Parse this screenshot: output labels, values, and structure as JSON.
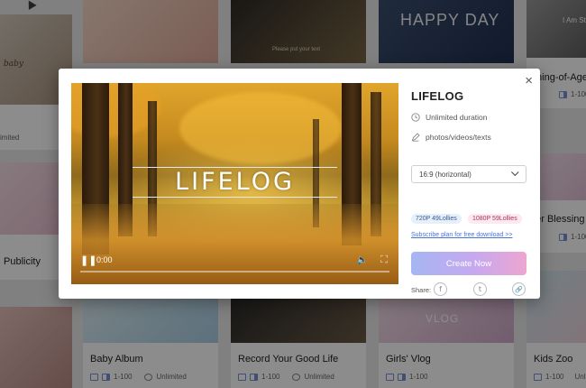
{
  "gallery": {
    "cards": [
      {
        "title": "re",
        "meta": "Unlimited",
        "size": "",
        "thumb_colors": [
          "#d8cfc4",
          "#b9a794"
        ],
        "thumb_text": "baby"
      },
      {
        "title": "",
        "meta": "",
        "size": "",
        "thumb_colors": [
          "#f4d8c6",
          "#e9b9a6"
        ],
        "thumb_text": ""
      },
      {
        "title": "",
        "meta": "",
        "size": "",
        "thumb_colors": [
          "#2e2a26",
          "#6a5a3c"
        ],
        "thumb_text": "Please put your text"
      },
      {
        "title": "",
        "meta": "",
        "size": "",
        "thumb_colors": [
          "#3a4e6e",
          "#1f3050"
        ],
        "thumb_text": "HAPPY DAY"
      },
      {
        "title": "ming-of-Age",
        "meta": "",
        "size": "1-100",
        "thumb_colors": [
          "#8f8f8f",
          "#5b5b5b"
        ],
        "thumb_text": "I Am St"
      },
      {
        "title": "Publicity",
        "meta": "",
        "size": "",
        "thumb_colors": [
          "#f6e3ea",
          "#eac3d3"
        ],
        "thumb_text": ""
      },
      {
        "title": "der Blessing",
        "meta": "",
        "size": "1-100",
        "thumb_colors": [
          "#f6e3ec",
          "#e6c8dc"
        ],
        "thumb_text": ""
      },
      {
        "title": "Baby Album",
        "meta": "Unlimited",
        "size": "1-100",
        "thumb_colors": [
          "#d9ecf4",
          "#b5d6e8"
        ],
        "thumb_text": ""
      },
      {
        "title": "Record Your Good Life",
        "meta": "Unlimited",
        "size": "1-100",
        "thumb_colors": [
          "#2b2b2b",
          "#5a4c3a"
        ],
        "thumb_text": ""
      },
      {
        "title": "Girls' Vlog",
        "meta": "",
        "size": "1-100",
        "thumb_colors": [
          "#f3dbe6",
          "#dcb9d3"
        ],
        "thumb_text": "VLOG"
      },
      {
        "title": "Kids Zoo",
        "meta": "Unlimited",
        "size": "1-100",
        "thumb_colors": [
          "#cfe6ee",
          "#f1d3db"
        ],
        "thumb_text": ""
      }
    ]
  },
  "modal": {
    "close_icon": "×",
    "player": {
      "title": "LIFELOG",
      "time": "0:00",
      "progress": 0,
      "play_icon": "❚❚",
      "volume_icon": "volume-icon",
      "fullscreen_icon": "fullscreen-icon"
    },
    "info": {
      "name": "LIFELOG",
      "duration": "Unlimited duration",
      "media": "photos/videos/texts",
      "ratio_selected": "16:9 (horizontal)",
      "price_720": "720P 49Lollies",
      "price_1080": "1080P 59Lollies",
      "subscribe_link": "Subscribe plan for free download >>",
      "create_button": "Create Now",
      "share_label": "Share:",
      "share_icons": [
        "f",
        "t",
        "🔗"
      ]
    }
  },
  "colors": {
    "accent_gradient_start": "#a6b6f3",
    "accent_gradient_end": "#eda6d0",
    "link": "#4a73d6"
  }
}
